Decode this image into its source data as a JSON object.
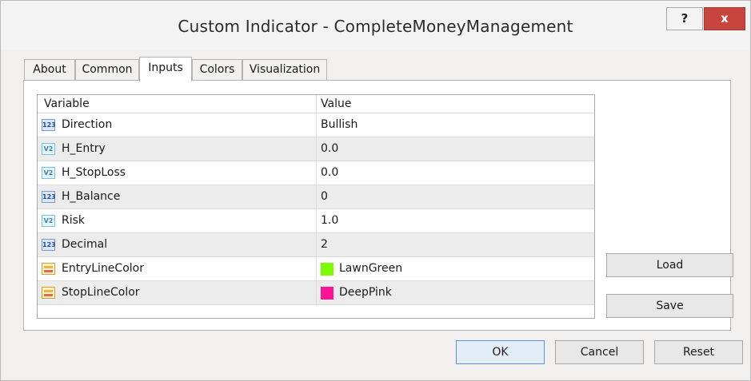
{
  "window": {
    "title": "Custom Indicator - CompleteMoneyManagement",
    "help_label": "?",
    "close_label": "x"
  },
  "tabs": [
    {
      "label": "About"
    },
    {
      "label": "Common"
    },
    {
      "label": "Inputs",
      "active": true
    },
    {
      "label": "Colors"
    },
    {
      "label": "Visualization"
    }
  ],
  "grid": {
    "columns": [
      "Variable",
      "Value"
    ],
    "rows": [
      {
        "type_icon": "int-icon",
        "type_text": "123",
        "name": "Direction",
        "value": "Bullish"
      },
      {
        "type_icon": "double-icon",
        "type_text": "V2",
        "name": "H_Entry",
        "value": "0.0"
      },
      {
        "type_icon": "double-icon",
        "type_text": "V2",
        "name": "H_StopLoss",
        "value": "0.0"
      },
      {
        "type_icon": "int-icon",
        "type_text": "123",
        "name": "H_Balance",
        "value": "0"
      },
      {
        "type_icon": "double-icon",
        "type_text": "V2",
        "name": "Risk",
        "value": "1.0"
      },
      {
        "type_icon": "int-icon",
        "type_text": "123",
        "name": "Decimal",
        "value": "2"
      },
      {
        "type_icon": "color-icon",
        "name": "EntryLineColor",
        "value": "LawnGreen",
        "swatch": "#7CFC00"
      },
      {
        "type_icon": "color-icon",
        "name": "StopLineColor",
        "value": "DeepPink",
        "swatch": "#FF1493"
      }
    ]
  },
  "side_buttons": {
    "load": "Load",
    "save": "Save"
  },
  "buttons": {
    "ok": "OK",
    "cancel": "Cancel",
    "reset": "Reset"
  },
  "colors": {
    "close_button": "#c7453d",
    "ok_border": "#5f93cf"
  }
}
